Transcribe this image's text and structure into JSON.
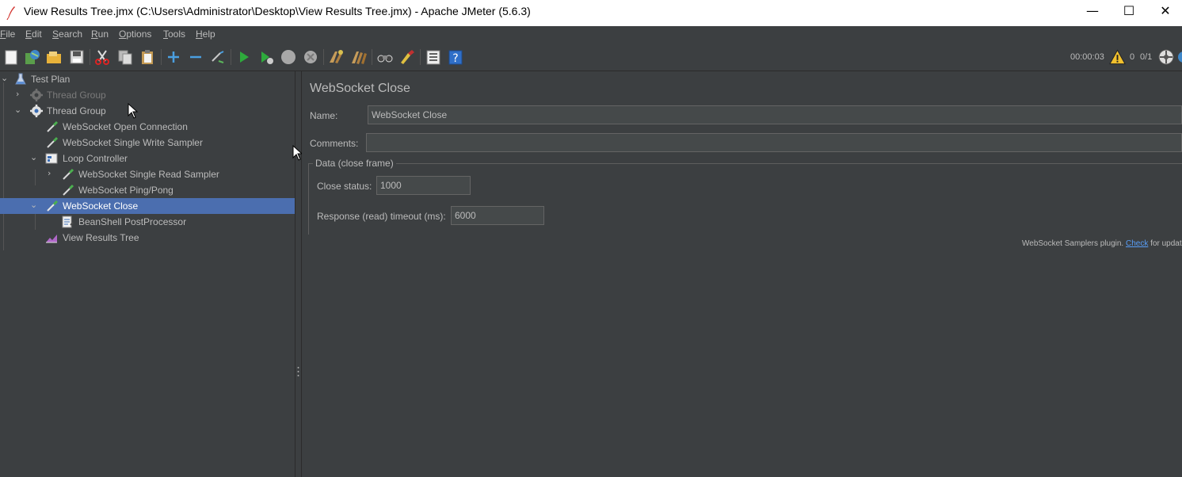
{
  "window": {
    "title": "View Results Tree.jmx (C:\\Users\\Administrator\\Desktop\\View Results Tree.jmx) - Apache JMeter (5.6.3)",
    "minimize": "—",
    "maximize": "☐",
    "close": "✕"
  },
  "menu": {
    "file": {
      "key": "F",
      "rest": "ile"
    },
    "edit": {
      "key": "E",
      "rest": "dit"
    },
    "search": {
      "key": "S",
      "rest": "earch"
    },
    "run": {
      "key": "R",
      "rest": "un"
    },
    "options": {
      "key": "O",
      "rest": "ptions"
    },
    "tools": {
      "key": "T",
      "rest": "ools"
    },
    "help": {
      "key": "H",
      "rest": "elp"
    }
  },
  "toolbar": {
    "icons": [
      "new-icon",
      "templates-icon",
      "open-icon",
      "save-icon",
      "cut-icon",
      "copy-icon",
      "paste-icon",
      "expand-icon",
      "collapse-icon",
      "toggle-icon",
      "start-icon",
      "start-no-pauses-icon",
      "stop-icon",
      "shutdown-icon",
      "clear-icon",
      "clear-all-icon",
      "search-icon",
      "reset-search-icon",
      "function-helper-icon",
      "help-icon"
    ],
    "elapsed_time": "00:00:03",
    "warning_count": "0",
    "active_threads": "0/1"
  },
  "tree": {
    "nodes": [
      {
        "label": "Test Plan",
        "icon": "test-plan-icon",
        "expanded": true,
        "enabled": true
      },
      {
        "label": "Thread Group",
        "icon": "gear-icon",
        "expanded": false,
        "enabled": false
      },
      {
        "label": "Thread Group",
        "icon": "gear-icon",
        "expanded": true,
        "enabled": true
      },
      {
        "label": "WebSocket Open Connection",
        "icon": "pipette-icon",
        "enabled": true
      },
      {
        "label": "WebSocket Single Write Sampler",
        "icon": "pipette-icon",
        "enabled": true
      },
      {
        "label": "Loop Controller",
        "icon": "controller-icon",
        "expanded": true,
        "enabled": true
      },
      {
        "label": "WebSocket Single Read Sampler",
        "icon": "pipette-icon",
        "expanded": false,
        "enabled": true
      },
      {
        "label": "WebSocket Ping/Pong",
        "icon": "pipette-icon",
        "enabled": true
      },
      {
        "label": "WebSocket Close",
        "icon": "pipette-icon",
        "expanded": true,
        "enabled": true,
        "selected": true
      },
      {
        "label": "BeanShell PostProcessor",
        "icon": "script-icon",
        "enabled": true
      },
      {
        "label": "View Results Tree",
        "icon": "listener-icon",
        "enabled": true
      }
    ]
  },
  "panel": {
    "title": "WebSocket Close",
    "name_label": "Name:",
    "name_value": "WebSocket Close",
    "comments_label": "Comments:",
    "comments_value": "",
    "group_title": "Data (close frame)",
    "close_status_label": "Close status:",
    "close_status_value": "1000",
    "timeout_label": "Response (read) timeout (ms):",
    "timeout_value": "6000",
    "plugin_note_prefix": "WebSocket Samplers plugin.",
    "plugin_link": "Check",
    "plugin_note_suffix": "for updates"
  },
  "colors": {
    "background": "#3c3f41",
    "selection": "#4b6eaf",
    "text": "#bbbbbb",
    "link": "#589df6"
  }
}
